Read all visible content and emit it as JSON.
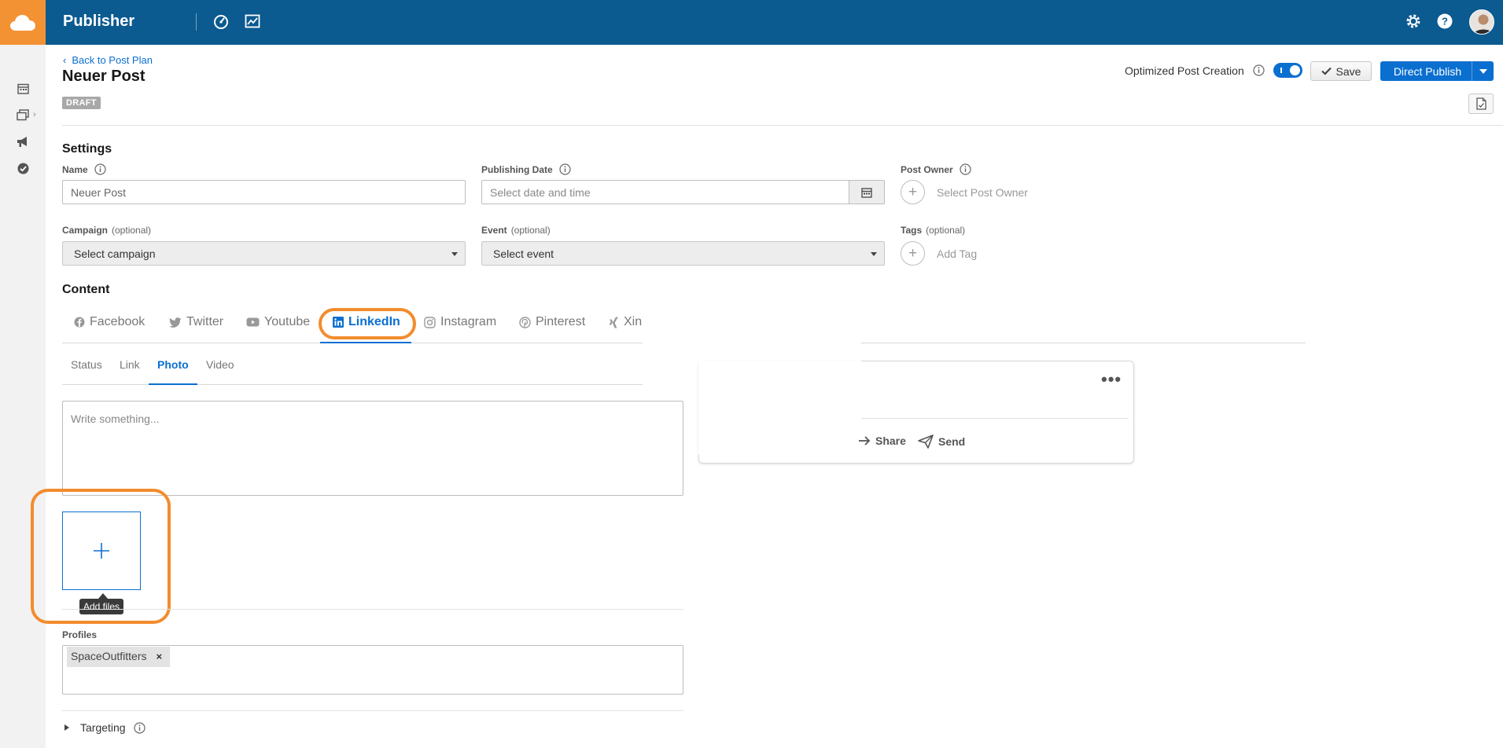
{
  "app": {
    "title": "Publisher"
  },
  "topbar": {
    "icons": [
      "dashboard-icon",
      "analytics-icon",
      "settings-icon",
      "help-icon"
    ]
  },
  "leftrail": {
    "icons": [
      "calendar-icon",
      "posts-icon",
      "campaign-icon",
      "approval-icon"
    ]
  },
  "header": {
    "back_link": "Back to Post Plan",
    "title": "Neuer Post",
    "status_badge": "DRAFT",
    "optimized_label": "Optimized Post Creation",
    "optimized_toggle_on": true,
    "save_label": "Save",
    "publish_label": "Direct Publish"
  },
  "settings": {
    "title": "Settings",
    "name": {
      "label": "Name",
      "value": "Neuer Post"
    },
    "publishing_date": {
      "label": "Publishing Date",
      "placeholder": "Select date and time"
    },
    "post_owner": {
      "label": "Post Owner",
      "placeholder": "Select Post Owner"
    },
    "campaign": {
      "label": "Campaign",
      "optional": "(optional)",
      "selected": "Select campaign"
    },
    "event": {
      "label": "Event",
      "optional": "(optional)",
      "selected": "Select event"
    },
    "tags": {
      "label": "Tags",
      "optional": "(optional)",
      "placeholder": "Add Tag"
    }
  },
  "content": {
    "title": "Content",
    "network_tabs": [
      {
        "label": "Facebook",
        "icon": "facebook-icon"
      },
      {
        "label": "Twitter",
        "icon": "twitter-icon"
      },
      {
        "label": "Youtube",
        "icon": "youtube-icon"
      },
      {
        "label": "LinkedIn",
        "icon": "linkedin-icon",
        "active": true
      },
      {
        "label": "Instagram",
        "icon": "instagram-icon"
      },
      {
        "label": "Pinterest",
        "icon": "pinterest-icon"
      },
      {
        "label": "Xin",
        "icon": "xing-icon"
      }
    ],
    "post_type_tabs": [
      {
        "label": "Status"
      },
      {
        "label": "Link"
      },
      {
        "label": "Photo",
        "active": true
      },
      {
        "label": "Video"
      }
    ],
    "compose_placeholder": "Write something...",
    "add_files_tooltip": "Add files",
    "profiles_label": "Profiles",
    "profiles": [
      "SpaceOutfitters"
    ],
    "profile_remove": "×",
    "targeting_label": "Targeting"
  },
  "preview": {
    "share_label": "Share",
    "send_label": "Send"
  },
  "colors": {
    "topbar": "#0b5a90",
    "logo_tile": "#f39233",
    "accent": "#0b6fd0",
    "callout": "#f28c2e"
  }
}
